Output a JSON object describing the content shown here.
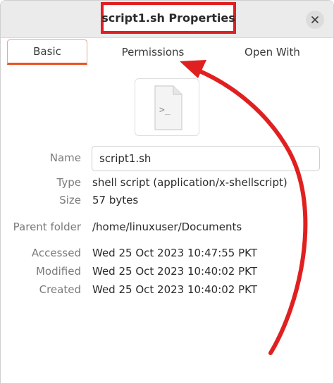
{
  "window": {
    "title": "script1.sh Properties"
  },
  "tabs": [
    {
      "label": "Basic",
      "active": true
    },
    {
      "label": "Permissions",
      "active": false
    },
    {
      "label": "Open With",
      "active": false
    }
  ],
  "file_icon": {
    "glyph": ">_"
  },
  "properties": {
    "name": {
      "label": "Name",
      "value": "script1.sh"
    },
    "type": {
      "label": "Type",
      "value": "shell script (application/x-shellscript)"
    },
    "size": {
      "label": "Size",
      "value": "57 bytes"
    },
    "parent_folder": {
      "label": "Parent folder",
      "value": "/home/linuxuser/Documents"
    },
    "accessed": {
      "label": "Accessed",
      "value": "Wed 25 Oct 2023 10:47:55 PKT"
    },
    "modified": {
      "label": "Modified",
      "value": "Wed 25 Oct 2023 10:40:02 PKT"
    },
    "created": {
      "label": "Created",
      "value": "Wed 25 Oct 2023 10:40:02 PKT"
    }
  },
  "colors": {
    "annotation": "#e02020",
    "accent": "#e95420"
  }
}
